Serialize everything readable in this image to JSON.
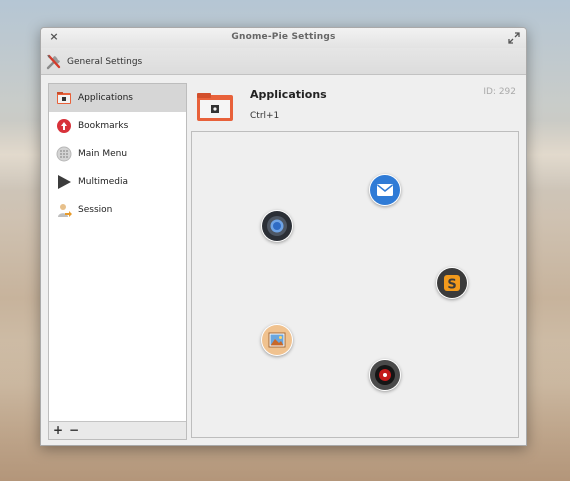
{
  "window": {
    "title": "Gnome-Pie Settings"
  },
  "toolbar": {
    "general_settings_label": "General Settings"
  },
  "sidebar": {
    "items": [
      {
        "label": "Applications",
        "icon": "applications-icon",
        "selected": true
      },
      {
        "label": "Bookmarks",
        "icon": "bookmarks-icon",
        "selected": false
      },
      {
        "label": "Main Menu",
        "icon": "main-menu-icon",
        "selected": false
      },
      {
        "label": "Multimedia",
        "icon": "multimedia-icon",
        "selected": false
      },
      {
        "label": "Session",
        "icon": "session-icon",
        "selected": false
      }
    ],
    "add_label": "+",
    "remove_label": "−"
  },
  "pie": {
    "name": "Applications",
    "hotkey": "Ctrl+1",
    "id_label": "ID: 292"
  },
  "preview": {
    "slices": [
      {
        "icon": "mail-icon"
      },
      {
        "icon": "sublime-text-icon"
      },
      {
        "icon": "screen-recorder-icon"
      },
      {
        "icon": "image-viewer-icon"
      },
      {
        "icon": "chromium-browser-icon"
      }
    ]
  },
  "colors": {
    "selected_row": "#d6d6d6",
    "window_bg": "#efefef",
    "accent_orange": "#e8613a"
  }
}
